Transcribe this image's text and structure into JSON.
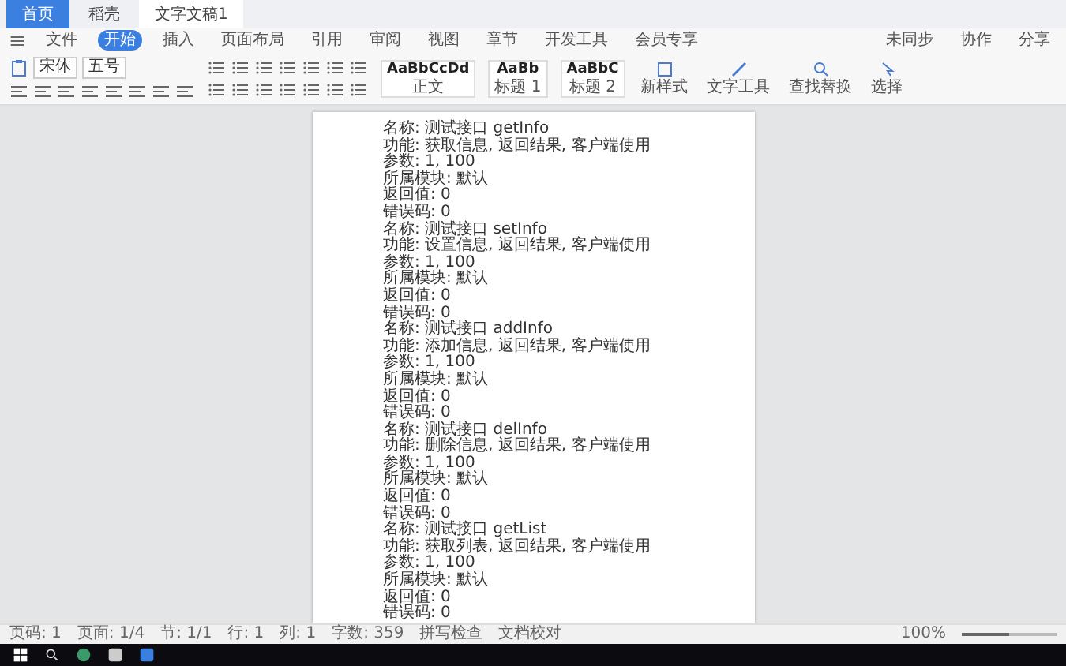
{
  "title_tabs": [
    {
      "label": "首页",
      "kind": "home",
      "selected": false
    },
    {
      "label": "稻壳",
      "kind": "store",
      "selected": false
    },
    {
      "label": "文字文稿1",
      "kind": "doc",
      "selected": true
    }
  ],
  "menu": {
    "file": "文件",
    "tabs": [
      {
        "label": "开始",
        "selected": true
      },
      {
        "label": "插入",
        "selected": false
      },
      {
        "label": "页面布局",
        "selected": false
      },
      {
        "label": "引用",
        "selected": false
      },
      {
        "label": "审阅",
        "selected": false
      },
      {
        "label": "视图",
        "selected": false
      },
      {
        "label": "章节",
        "selected": false
      },
      {
        "label": "开发工具",
        "selected": false
      },
      {
        "label": "会员专享",
        "selected": false
      }
    ],
    "actions": [
      "未同步",
      "协作",
      "分享"
    ]
  },
  "ribbon": {
    "font_name": "宋体",
    "font_size": "五号",
    "styles": [
      {
        "preview": "AaBbCcDd",
        "label": "正文"
      },
      {
        "preview": "AaBb",
        "label": "标题 1"
      },
      {
        "preview": "AaBbC",
        "label": "标题 2"
      }
    ],
    "tools": [
      "新样式",
      "文字工具",
      "查找替换",
      "选择"
    ]
  },
  "document": {
    "lines": [
      "名称: 测试接口 getInfo",
      "功能: 获取信息, 返回结果, 客户端使用",
      "参数: 1, 100",
      "所属模块: 默认",
      "返回值: 0",
      "错误码: 0",
      "名称: 测试接口 setInfo",
      "功能: 设置信息, 返回结果, 客户端使用",
      "参数: 1, 100",
      "所属模块: 默认",
      "返回值: 0",
      "错误码: 0",
      "名称: 测试接口 addInfo",
      "功能: 添加信息, 返回结果, 客户端使用",
      "参数: 1, 100",
      "所属模块: 默认",
      "返回值: 0",
      "错误码: 0",
      "名称: 测试接口 delInfo",
      "功能: 删除信息, 返回结果, 客户端使用",
      "参数: 1, 100",
      "所属模块: 默认",
      "返回值: 0",
      "错误码: 0",
      "名称: 测试接口 getList",
      "功能: 获取列表, 返回结果, 客户端使用",
      "参数: 1, 100",
      "所属模块: 默认",
      "返回值: 0",
      "错误码: 0"
    ]
  },
  "status_bar": {
    "items": [
      "页码: 1",
      "页面: 1/4",
      "节: 1/1",
      "行: 1",
      "列: 1",
      "字数: 359",
      "拼写检查",
      "文档校对"
    ],
    "zoom": "100%",
    "zoom_slider": {
      "level": 0.5
    }
  }
}
